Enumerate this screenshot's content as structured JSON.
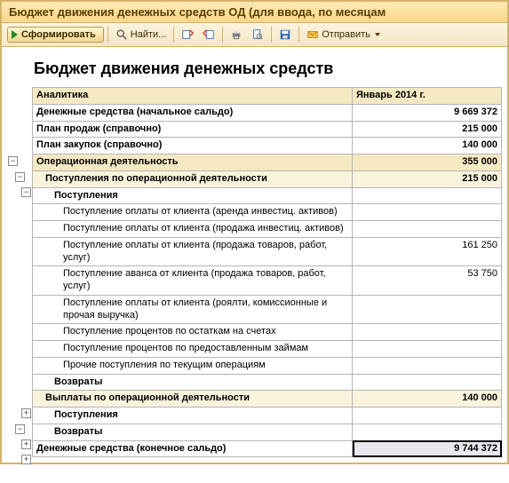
{
  "window": {
    "title": "Бюджет движения денежных средств ОД (для ввода, по месяцам"
  },
  "toolbar": {
    "form_label": "Сформировать",
    "find_label": "Найти...",
    "send_label": "Отправить"
  },
  "report": {
    "title": "Бюджет движения денежных средств",
    "col_analytics": "Аналитика",
    "col_period": "Январь 2014 г.",
    "rows": {
      "r0": {
        "label": "Денежные средства (начальное сальдо)",
        "value": "9 669 372"
      },
      "r1": {
        "label": "План продаж (справочно)",
        "value": "215 000"
      },
      "r2": {
        "label": "План закупок (справочно)",
        "value": "140 000"
      },
      "r3": {
        "label": "Операционная деятельность",
        "value": "355 000"
      },
      "r4": {
        "label": "Поступления по операционной деятельности",
        "value": "215 000"
      },
      "r5": {
        "label": "Поступления",
        "value": ""
      },
      "r6": {
        "label": "Поступление оплаты от клиента (аренда инвестиц. активов)",
        "value": ""
      },
      "r7": {
        "label": "Поступление оплаты от клиента (продажа инвестиц. активов)",
        "value": ""
      },
      "r8": {
        "label": "Поступление оплаты от клиента (продажа товаров, работ, услуг)",
        "value": "161 250"
      },
      "r9": {
        "label": "Поступление аванса от клиента (продажа товаров, работ, услуг)",
        "value": "53 750"
      },
      "r10": {
        "label": "Поступление оплаты от клиента (роялти, комиссионные и прочая выручка)",
        "value": ""
      },
      "r11": {
        "label": "Поступление процентов по остаткам на счетах",
        "value": ""
      },
      "r12": {
        "label": "Поступление процентов по предоставленным займам",
        "value": ""
      },
      "r13": {
        "label": "Прочие поступления по текущим операциям",
        "value": ""
      },
      "r14": {
        "label": "Возвраты",
        "value": ""
      },
      "r15": {
        "label": "Выплаты по операционной деятельности",
        "value": "140 000"
      },
      "r16": {
        "label": "Поступления",
        "value": ""
      },
      "r17": {
        "label": "Возвраты",
        "value": ""
      },
      "r18": {
        "label": "Денежные средства (конечное сальдо)",
        "value": "9 744 372"
      }
    }
  }
}
